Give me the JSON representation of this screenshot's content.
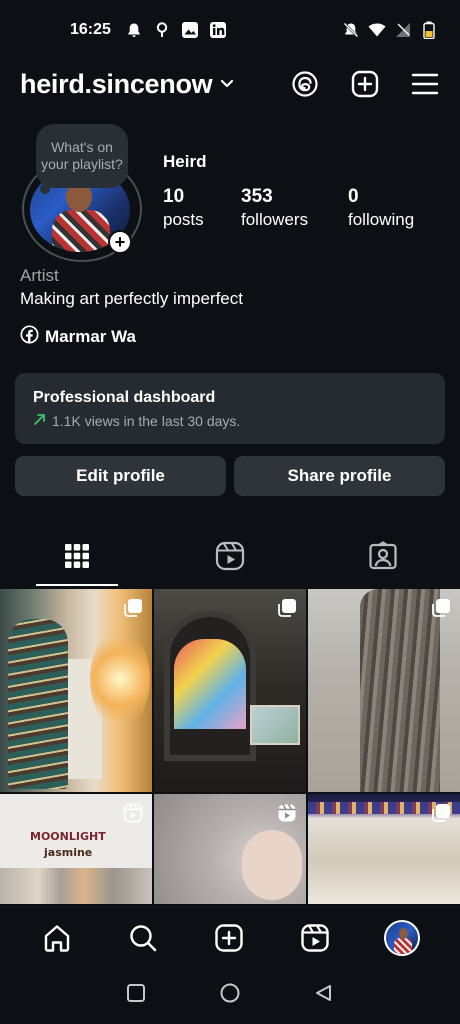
{
  "status_bar": {
    "time": "16:25"
  },
  "header": {
    "username": "heird.sincenow"
  },
  "profile": {
    "note_text": "What's on your playlist?",
    "display_name": "Heird",
    "stats": [
      {
        "value": "10",
        "label": "posts"
      },
      {
        "value": "353",
        "label": "followers"
      },
      {
        "value": "0",
        "label": "following"
      }
    ],
    "category": "Artist",
    "bio": "Making art perfectly imperfect",
    "facebook_name": "Marmar Wa"
  },
  "dashboard": {
    "title": "Professional dashboard",
    "subtitle": "1.1K views in the last 30 days.",
    "accent_color": "#3ec26a"
  },
  "buttons": {
    "edit_profile": "Edit profile",
    "share_profile": "Share profile"
  },
  "tabs": [
    {
      "icon": "grid-icon",
      "active": true
    },
    {
      "icon": "reels-icon",
      "active": false
    },
    {
      "icon": "tagged-icon",
      "active": false
    }
  ],
  "grid": {
    "cell4_text_line1": "MOONLIGHT",
    "cell4_text_line2": "jasmine"
  },
  "bottom_nav": [
    "home-icon",
    "search-icon",
    "create-icon",
    "reels-icon",
    "profile-avatar"
  ],
  "colors": {
    "background": "#0c1014",
    "card": "#262a31",
    "button": "#2f333a",
    "muted_text": "#a8acb2"
  }
}
